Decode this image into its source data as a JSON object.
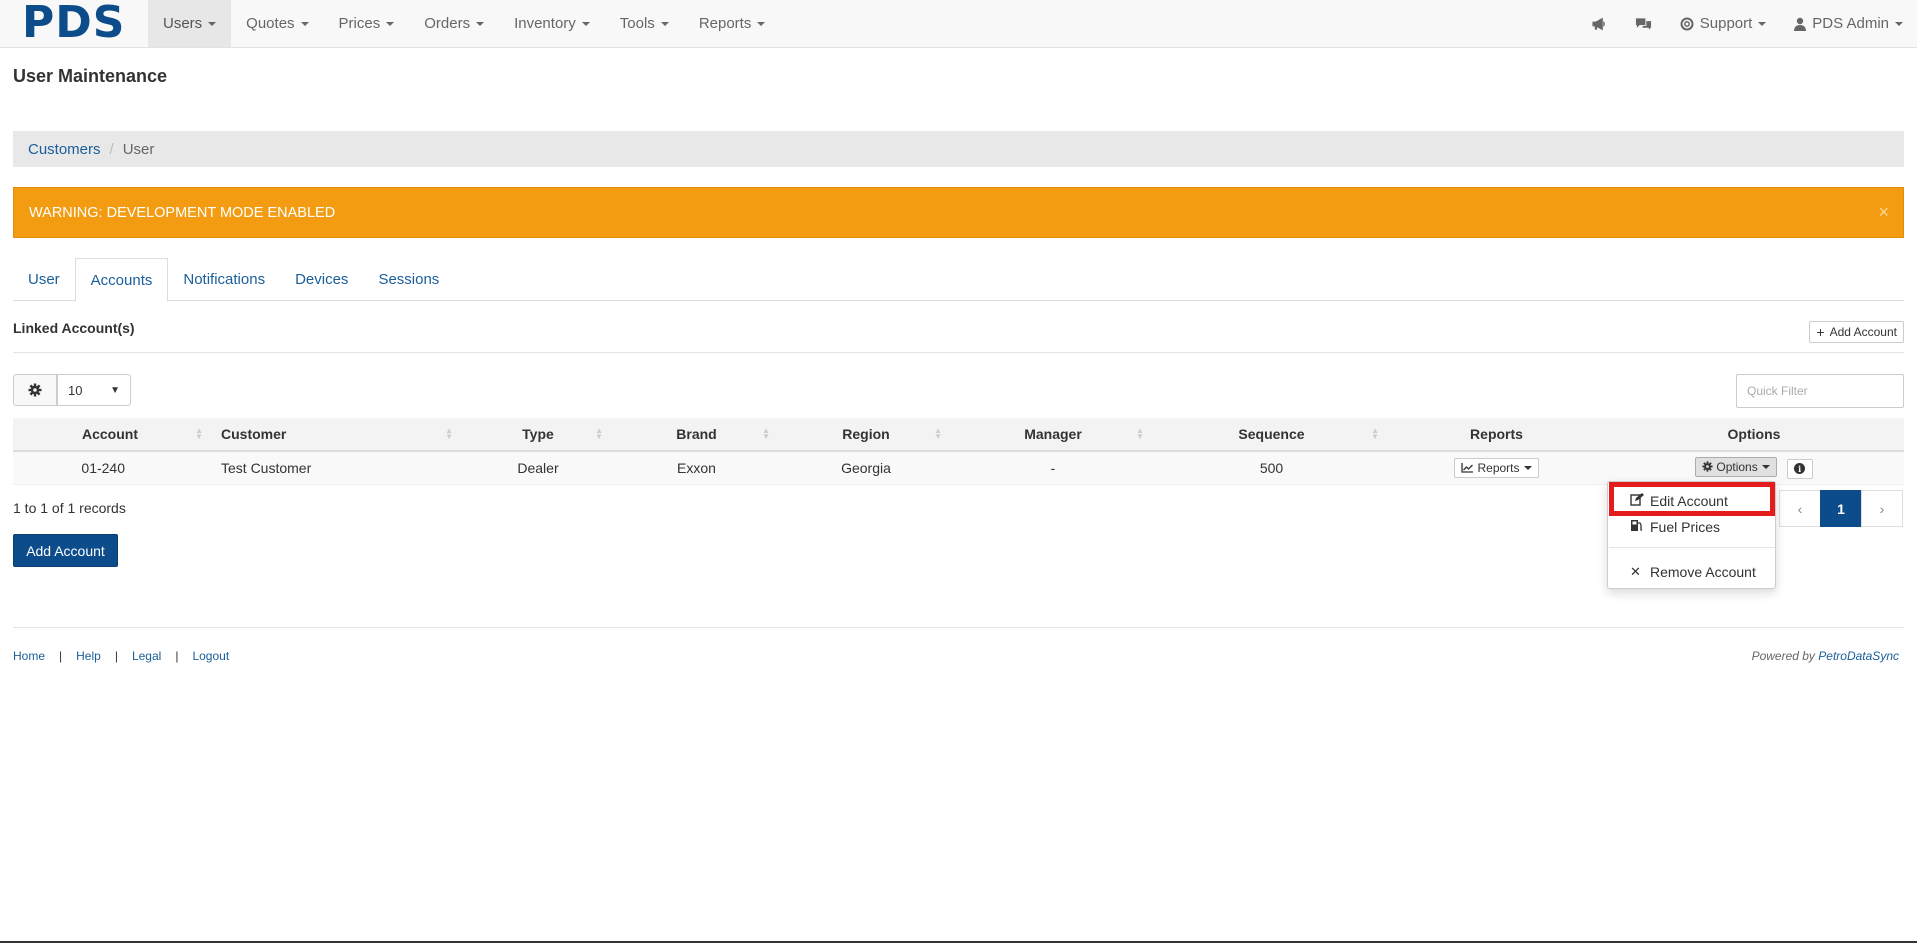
{
  "brand": {
    "logo": "PDS"
  },
  "nav": {
    "items": [
      {
        "label": "Users"
      },
      {
        "label": "Quotes"
      },
      {
        "label": "Prices"
      },
      {
        "label": "Orders"
      },
      {
        "label": "Inventory"
      },
      {
        "label": "Tools"
      },
      {
        "label": "Reports"
      }
    ],
    "support": "Support",
    "user": "PDS Admin"
  },
  "page": {
    "title": "User Maintenance"
  },
  "breadcrumb": {
    "items": [
      "Customers",
      "User"
    ],
    "separator": "/"
  },
  "alert": {
    "text": "WARNING: DEVELOPMENT MODE ENABLED",
    "close": "×"
  },
  "tabs": [
    "User",
    "Accounts",
    "Notifications",
    "Devices",
    "Sessions"
  ],
  "linked": {
    "title": "Linked Account(s)",
    "add_button": "Add Account",
    "page_size": "10",
    "filter_placeholder": "Quick Filter"
  },
  "table": {
    "headers": [
      "Account",
      "Customer",
      "Type",
      "Brand",
      "Region",
      "Manager",
      "Sequence",
      "Reports",
      "Options"
    ],
    "rows": [
      {
        "account": "01-240",
        "customer": "Test Customer",
        "type": "Dealer",
        "brand": "Exxon",
        "region": "Georgia",
        "manager": "-",
        "sequence": "500",
        "reports_btn": "Reports",
        "options_btn": "Options"
      }
    ],
    "records_text": "1 to 1 of 1 records",
    "add_account_button": "Add Account"
  },
  "pagination": {
    "prev": "‹",
    "current": "1",
    "next": "›"
  },
  "dropdown": {
    "items": [
      "Edit Account",
      "Fuel Prices",
      "Remove Account"
    ]
  },
  "footer": {
    "links": [
      "Home",
      "Help",
      "Legal",
      "Logout"
    ],
    "powered_prefix": "Powered by",
    "powered_link": "PetroDataSync"
  },
  "colors": {
    "brand": "#0d4c8b",
    "warning": "#f39c12",
    "highlight": "#e41c1c",
    "link": "#1b5e9a"
  }
}
